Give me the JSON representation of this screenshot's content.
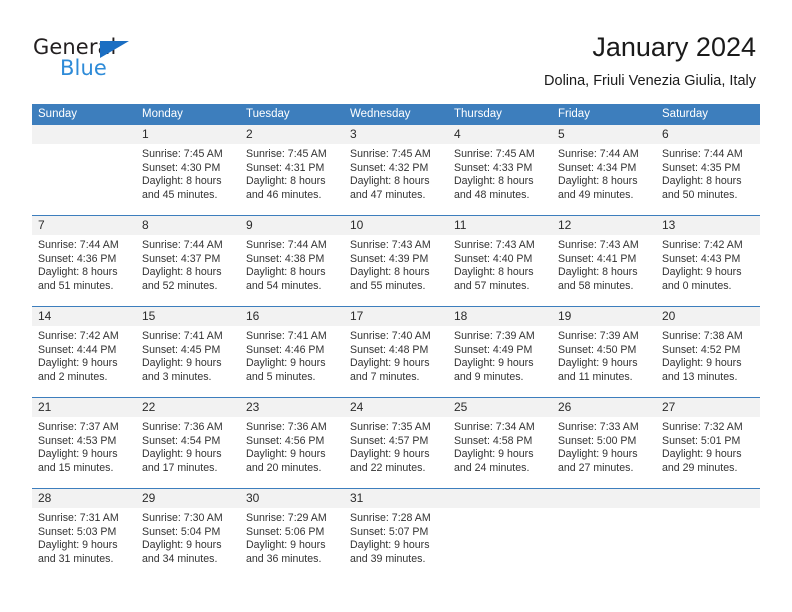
{
  "brand": {
    "name_part1": "General",
    "name_part2": "Blue",
    "triangle_color": "#1b6ec2",
    "blue_color": "#2e8bd8"
  },
  "header": {
    "title": "January 2024",
    "subtitle": "Dolina, Friuli Venezia Giulia, Italy"
  },
  "theme": {
    "header_bg": "#3d7ebd",
    "daynum_bg": "#f2f2f2",
    "cell_bg": "#ffffff",
    "text": "#333333"
  },
  "weekdays": [
    "Sunday",
    "Monday",
    "Tuesday",
    "Wednesday",
    "Thursday",
    "Friday",
    "Saturday"
  ],
  "weeks": [
    {
      "days": [
        {
          "num": "",
          "l1": "",
          "l2": "",
          "l3": "",
          "l4": ""
        },
        {
          "num": "1",
          "l1": "Sunrise: 7:45 AM",
          "l2": "Sunset: 4:30 PM",
          "l3": "Daylight: 8 hours",
          "l4": "and 45 minutes."
        },
        {
          "num": "2",
          "l1": "Sunrise: 7:45 AM",
          "l2": "Sunset: 4:31 PM",
          "l3": "Daylight: 8 hours",
          "l4": "and 46 minutes."
        },
        {
          "num": "3",
          "l1": "Sunrise: 7:45 AM",
          "l2": "Sunset: 4:32 PM",
          "l3": "Daylight: 8 hours",
          "l4": "and 47 minutes."
        },
        {
          "num": "4",
          "l1": "Sunrise: 7:45 AM",
          "l2": "Sunset: 4:33 PM",
          "l3": "Daylight: 8 hours",
          "l4": "and 48 minutes."
        },
        {
          "num": "5",
          "l1": "Sunrise: 7:44 AM",
          "l2": "Sunset: 4:34 PM",
          "l3": "Daylight: 8 hours",
          "l4": "and 49 minutes."
        },
        {
          "num": "6",
          "l1": "Sunrise: 7:44 AM",
          "l2": "Sunset: 4:35 PM",
          "l3": "Daylight: 8 hours",
          "l4": "and 50 minutes."
        }
      ]
    },
    {
      "days": [
        {
          "num": "7",
          "l1": "Sunrise: 7:44 AM",
          "l2": "Sunset: 4:36 PM",
          "l3": "Daylight: 8 hours",
          "l4": "and 51 minutes."
        },
        {
          "num": "8",
          "l1": "Sunrise: 7:44 AM",
          "l2": "Sunset: 4:37 PM",
          "l3": "Daylight: 8 hours",
          "l4": "and 52 minutes."
        },
        {
          "num": "9",
          "l1": "Sunrise: 7:44 AM",
          "l2": "Sunset: 4:38 PM",
          "l3": "Daylight: 8 hours",
          "l4": "and 54 minutes."
        },
        {
          "num": "10",
          "l1": "Sunrise: 7:43 AM",
          "l2": "Sunset: 4:39 PM",
          "l3": "Daylight: 8 hours",
          "l4": "and 55 minutes."
        },
        {
          "num": "11",
          "l1": "Sunrise: 7:43 AM",
          "l2": "Sunset: 4:40 PM",
          "l3": "Daylight: 8 hours",
          "l4": "and 57 minutes."
        },
        {
          "num": "12",
          "l1": "Sunrise: 7:43 AM",
          "l2": "Sunset: 4:41 PM",
          "l3": "Daylight: 8 hours",
          "l4": "and 58 minutes."
        },
        {
          "num": "13",
          "l1": "Sunrise: 7:42 AM",
          "l2": "Sunset: 4:43 PM",
          "l3": "Daylight: 9 hours",
          "l4": "and 0 minutes."
        }
      ]
    },
    {
      "days": [
        {
          "num": "14",
          "l1": "Sunrise: 7:42 AM",
          "l2": "Sunset: 4:44 PM",
          "l3": "Daylight: 9 hours",
          "l4": "and 2 minutes."
        },
        {
          "num": "15",
          "l1": "Sunrise: 7:41 AM",
          "l2": "Sunset: 4:45 PM",
          "l3": "Daylight: 9 hours",
          "l4": "and 3 minutes."
        },
        {
          "num": "16",
          "l1": "Sunrise: 7:41 AM",
          "l2": "Sunset: 4:46 PM",
          "l3": "Daylight: 9 hours",
          "l4": "and 5 minutes."
        },
        {
          "num": "17",
          "l1": "Sunrise: 7:40 AM",
          "l2": "Sunset: 4:48 PM",
          "l3": "Daylight: 9 hours",
          "l4": "and 7 minutes."
        },
        {
          "num": "18",
          "l1": "Sunrise: 7:39 AM",
          "l2": "Sunset: 4:49 PM",
          "l3": "Daylight: 9 hours",
          "l4": "and 9 minutes."
        },
        {
          "num": "19",
          "l1": "Sunrise: 7:39 AM",
          "l2": "Sunset: 4:50 PM",
          "l3": "Daylight: 9 hours",
          "l4": "and 11 minutes."
        },
        {
          "num": "20",
          "l1": "Sunrise: 7:38 AM",
          "l2": "Sunset: 4:52 PM",
          "l3": "Daylight: 9 hours",
          "l4": "and 13 minutes."
        }
      ]
    },
    {
      "days": [
        {
          "num": "21",
          "l1": "Sunrise: 7:37 AM",
          "l2": "Sunset: 4:53 PM",
          "l3": "Daylight: 9 hours",
          "l4": "and 15 minutes."
        },
        {
          "num": "22",
          "l1": "Sunrise: 7:36 AM",
          "l2": "Sunset: 4:54 PM",
          "l3": "Daylight: 9 hours",
          "l4": "and 17 minutes."
        },
        {
          "num": "23",
          "l1": "Sunrise: 7:36 AM",
          "l2": "Sunset: 4:56 PM",
          "l3": "Daylight: 9 hours",
          "l4": "and 20 minutes."
        },
        {
          "num": "24",
          "l1": "Sunrise: 7:35 AM",
          "l2": "Sunset: 4:57 PM",
          "l3": "Daylight: 9 hours",
          "l4": "and 22 minutes."
        },
        {
          "num": "25",
          "l1": "Sunrise: 7:34 AM",
          "l2": "Sunset: 4:58 PM",
          "l3": "Daylight: 9 hours",
          "l4": "and 24 minutes."
        },
        {
          "num": "26",
          "l1": "Sunrise: 7:33 AM",
          "l2": "Sunset: 5:00 PM",
          "l3": "Daylight: 9 hours",
          "l4": "and 27 minutes."
        },
        {
          "num": "27",
          "l1": "Sunrise: 7:32 AM",
          "l2": "Sunset: 5:01 PM",
          "l3": "Daylight: 9 hours",
          "l4": "and 29 minutes."
        }
      ]
    },
    {
      "days": [
        {
          "num": "28",
          "l1": "Sunrise: 7:31 AM",
          "l2": "Sunset: 5:03 PM",
          "l3": "Daylight: 9 hours",
          "l4": "and 31 minutes."
        },
        {
          "num": "29",
          "l1": "Sunrise: 7:30 AM",
          "l2": "Sunset: 5:04 PM",
          "l3": "Daylight: 9 hours",
          "l4": "and 34 minutes."
        },
        {
          "num": "30",
          "l1": "Sunrise: 7:29 AM",
          "l2": "Sunset: 5:06 PM",
          "l3": "Daylight: 9 hours",
          "l4": "and 36 minutes."
        },
        {
          "num": "31",
          "l1": "Sunrise: 7:28 AM",
          "l2": "Sunset: 5:07 PM",
          "l3": "Daylight: 9 hours",
          "l4": "and 39 minutes."
        },
        {
          "num": "",
          "l1": "",
          "l2": "",
          "l3": "",
          "l4": ""
        },
        {
          "num": "",
          "l1": "",
          "l2": "",
          "l3": "",
          "l4": ""
        },
        {
          "num": "",
          "l1": "",
          "l2": "",
          "l3": "",
          "l4": ""
        }
      ]
    }
  ]
}
